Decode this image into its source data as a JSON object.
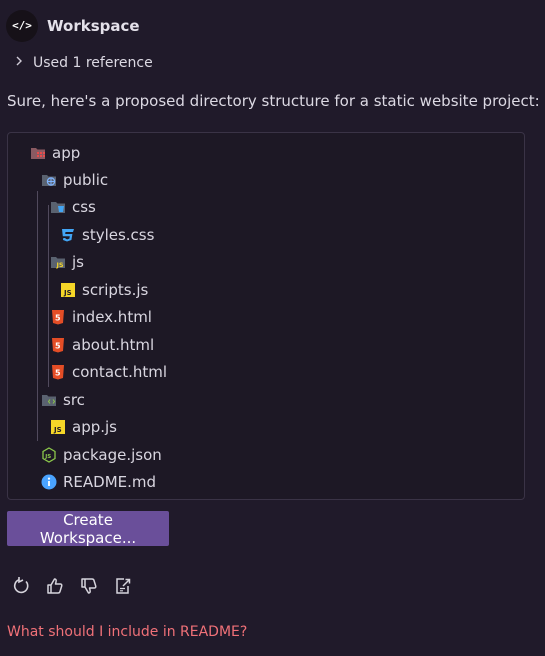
{
  "header": {
    "title": "Workspace",
    "avatar_glyph": "</>",
    "avatar_icon": "code-icon"
  },
  "references": {
    "label": "Used 1 reference",
    "icon": "chevron-right-icon"
  },
  "intro": "Sure, here's a proposed directory structure for a static website project:",
  "tree": [
    {
      "name": "app",
      "icon": "folder-app-icon"
    },
    {
      "name": "public",
      "icon": "folder-public-icon"
    },
    {
      "name": "css",
      "icon": "folder-css-icon"
    },
    {
      "name": "styles.css",
      "icon": "css-file-icon"
    },
    {
      "name": "js",
      "icon": "folder-js-icon"
    },
    {
      "name": "scripts.js",
      "icon": "js-file-icon"
    },
    {
      "name": "index.html",
      "icon": "html-file-icon"
    },
    {
      "name": "about.html",
      "icon": "html-file-icon"
    },
    {
      "name": "contact.html",
      "icon": "html-file-icon"
    },
    {
      "name": "src",
      "icon": "folder-src-icon"
    },
    {
      "name": "app.js",
      "icon": "js-file-icon"
    },
    {
      "name": "package.json",
      "icon": "nodejs-icon"
    },
    {
      "name": "README.md",
      "icon": "info-icon"
    }
  ],
  "button": {
    "label": "Create Workspace..."
  },
  "actions": [
    {
      "name": "retry-icon"
    },
    {
      "name": "thumbs-up-icon"
    },
    {
      "name": "thumbs-down-icon"
    },
    {
      "name": "insert-into-editor-icon"
    }
  ],
  "suggestion": "What should I include in README?",
  "colors": {
    "background": "#201a2a",
    "button": "#6a4f9a",
    "suggestion": "#f07178",
    "html": "#e44d26",
    "css": "#42a5f5",
    "js": "#f5d628",
    "info": "#4aa3ff",
    "node": "#8cc84b"
  }
}
